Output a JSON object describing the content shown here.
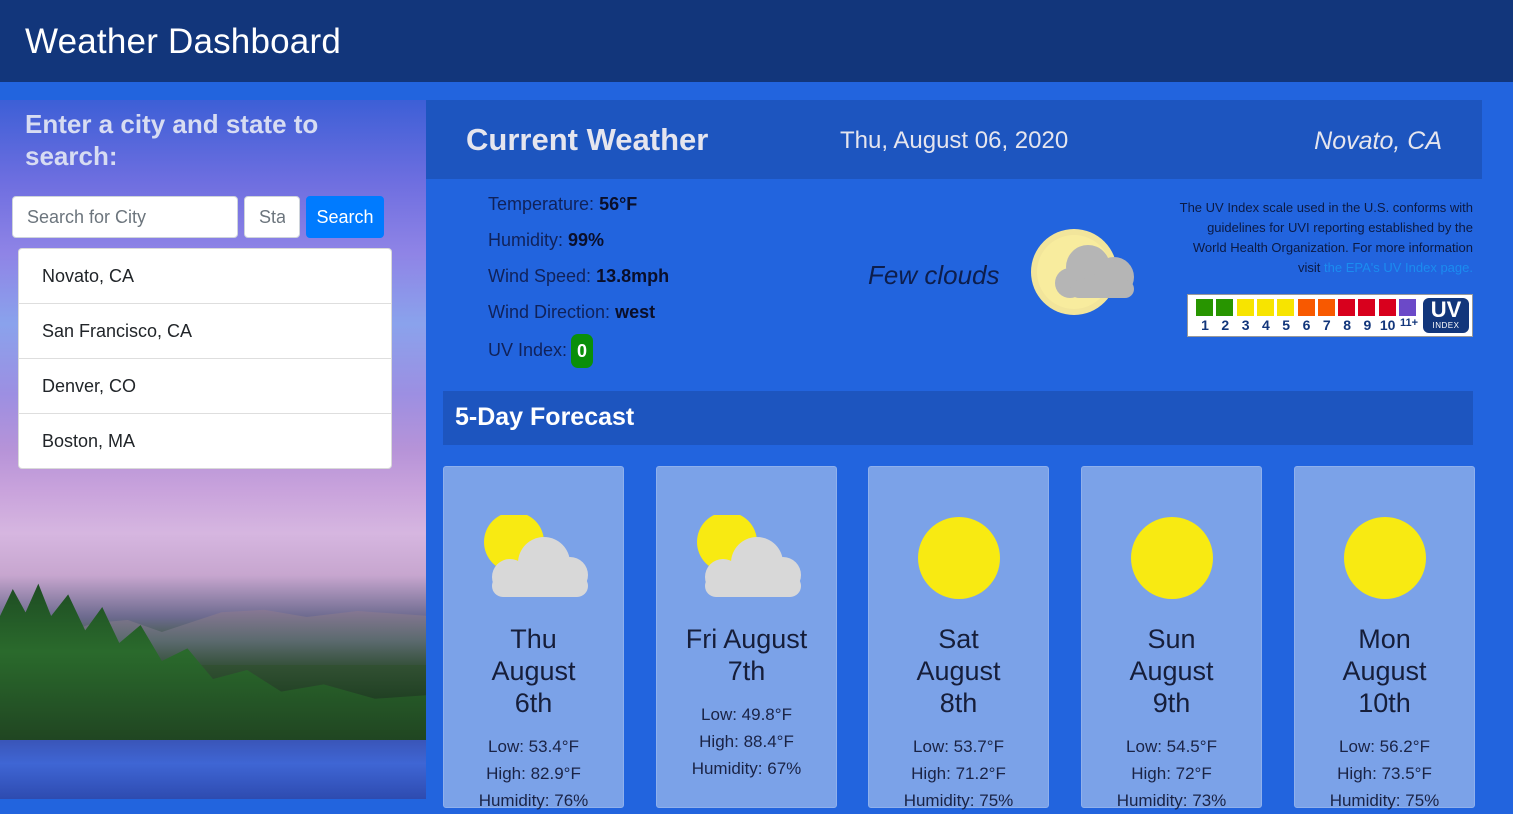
{
  "app": {
    "title": "Weather Dashboard"
  },
  "search": {
    "prompt": "Enter a city and state to search:",
    "city_placeholder": "Search for City",
    "state_placeholder": "State",
    "button_label": "Search"
  },
  "history": [
    "Novato, CA",
    "San Francisco, CA",
    "Denver, CO",
    "Boston, MA"
  ],
  "current": {
    "title": "Current Weather",
    "date": "Thu, August 06, 2020",
    "location": "Novato, CA",
    "temperature_label": "Temperature:",
    "temperature": "56°F",
    "humidity_label": "Humidity:",
    "humidity": "99%",
    "wind_speed_label": "Wind Speed:",
    "wind_speed": "13.8mph",
    "wind_direction_label": "Wind Direction:",
    "wind_direction": "west",
    "uv_label": "UV Index:",
    "uv": "0",
    "description": "Few clouds",
    "icon": "moon-cloud-icon"
  },
  "uv_info": {
    "note": "The UV Index scale used in the U.S. conforms with guidelines for UVI reporting established by the World Health Organization. For more information visit",
    "link": "the EPA's UV Index page.",
    "scale": [
      "1",
      "2",
      "3",
      "4",
      "5",
      "6",
      "7",
      "8",
      "9",
      "10",
      "11+"
    ],
    "colors": [
      "#289500",
      "#289500",
      "#f7e400",
      "#f7e400",
      "#f7e400",
      "#f85900",
      "#f85900",
      "#d8001d",
      "#d8001d",
      "#d8001d",
      "#6b49c8"
    ],
    "logo_big": "UV",
    "logo_small": "INDEX"
  },
  "forecast": {
    "title": "5-Day Forecast",
    "days": [
      {
        "day": "Thu August 6th",
        "low": "Low: 53.4°F",
        "high": "High: 82.9°F",
        "humidity": "Humidity: 76%",
        "icon": "sun-cloud-icon"
      },
      {
        "day": "Fri August 7th",
        "low": "Low: 49.8°F",
        "high": "High: 88.4°F",
        "humidity": "Humidity: 67%",
        "icon": "sun-cloud-icon"
      },
      {
        "day": "Sat August 8th",
        "low": "Low: 53.7°F",
        "high": "High: 71.2°F",
        "humidity": "Humidity: 75%",
        "icon": "sun-icon"
      },
      {
        "day": "Sun August 9th",
        "low": "Low: 54.5°F",
        "high": "High: 72°F",
        "humidity": "Humidity: 73%",
        "icon": "sun-icon"
      },
      {
        "day": "Mon August 10th",
        "low": "Low: 56.2°F",
        "high": "High: 73.5°F",
        "humidity": "Humidity: 75%",
        "icon": "sun-icon"
      }
    ]
  }
}
